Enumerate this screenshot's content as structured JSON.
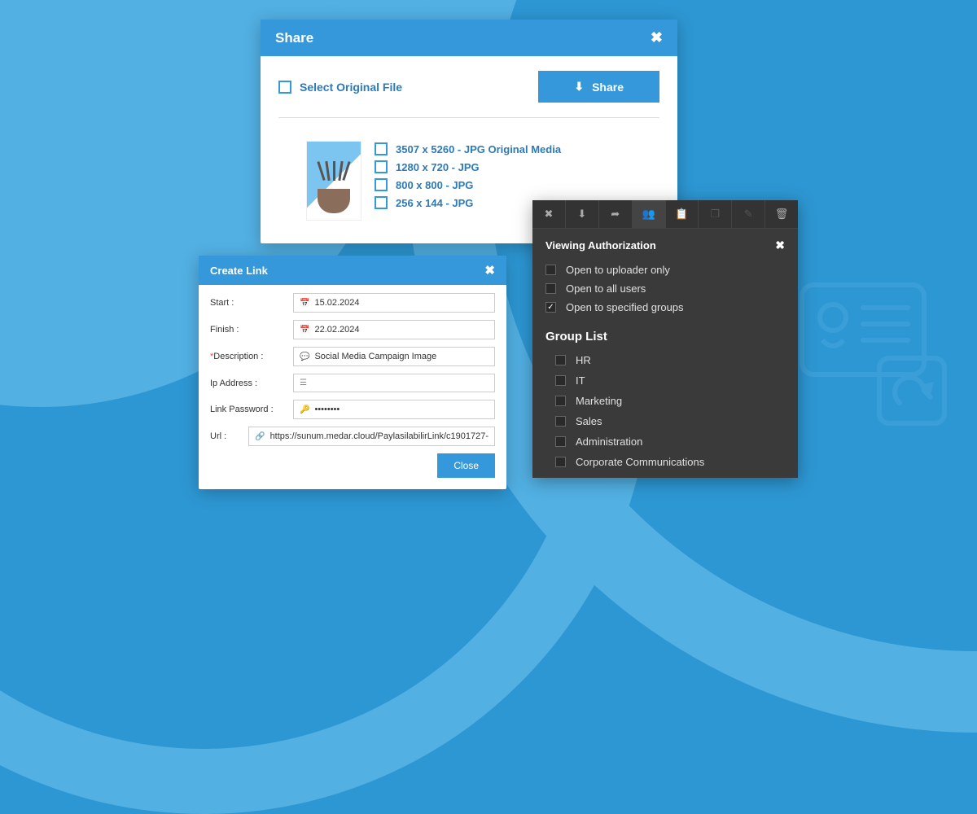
{
  "share": {
    "title": "Share",
    "select_original": "Select Original File",
    "share_btn": "Share",
    "formats": [
      "3507 x 5260 - JPG Original Media",
      "1280 x 720 - JPG",
      "800 x 800 - JPG",
      "256 x 144 - JPG"
    ]
  },
  "createLink": {
    "title": "Create Link",
    "labels": {
      "start": "Start :",
      "finish": "Finish :",
      "description": "Description :",
      "ip": "Ip Address :",
      "password": "Link Password :",
      "url": "Url :"
    },
    "values": {
      "start": "15.02.2024",
      "finish": "22.02.2024",
      "description": "Social Media Campaign Image",
      "ip": "",
      "password": "••••••••",
      "url": "https://sunum.medar.cloud/PaylasilabilirLink/c1901727-"
    },
    "close": "Close"
  },
  "auth": {
    "title": "Viewing Authorization",
    "options": [
      {
        "label": "Open to uploader only",
        "checked": false
      },
      {
        "label": "Open to all users",
        "checked": false
      },
      {
        "label": "Open to specified groups",
        "checked": true
      }
    ],
    "group_list_label": "Group List",
    "groups": [
      "HR",
      "IT",
      "Marketing",
      "Sales",
      "Administration",
      "Corporate Communications"
    ]
  }
}
